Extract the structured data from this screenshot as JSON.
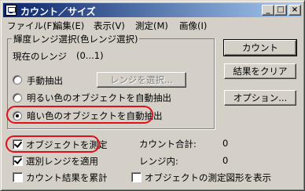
{
  "window": {
    "title": "カウント／サイズ",
    "controls": {
      "minimize": "_",
      "maximize": "□",
      "close": "×"
    }
  },
  "menu": [
    {
      "label": "ファイル(F)"
    },
    {
      "label": "編集(E)"
    },
    {
      "label": "表示(V)"
    },
    {
      "label": "測定(M)"
    },
    {
      "label": "画像(I)"
    }
  ],
  "group": {
    "label": "輝度レンジ選択(色レンジ選択)",
    "current_range_label": "現在のレンジ",
    "current_range_value": "(0...1)"
  },
  "radios": {
    "manual": {
      "label": "手動抽出",
      "checked": false
    },
    "bright": {
      "label": "明るい色のオブジェクトを自動抽出",
      "checked": false
    },
    "dark": {
      "label": "暗い色のオブジェクトを自動抽出",
      "checked": true
    }
  },
  "buttons": {
    "select_range": "レンジを選択...",
    "count": "カウント",
    "clear_results": "結果をクリア",
    "options": "オプション..."
  },
  "checkboxes": {
    "measure_objects": {
      "label": "オブジェクトを測定",
      "checked": true
    },
    "apply_filter_ranges": {
      "label": "選別レンジを適用",
      "checked": true
    },
    "accumulate_count": {
      "label": "カウント結果を累計",
      "checked": false
    },
    "display_object_outlines": {
      "label": "オブジェクトの測定図形を表示",
      "checked": false
    }
  },
  "stats": {
    "total_count_label": "カウント合計:",
    "total_count_value": "0",
    "in_range_label": "レンジ内:",
    "in_range_value": "0"
  },
  "highlights": {
    "color": "#e0101a"
  },
  "colors": {
    "face": "#d4d0c8",
    "title_start": "#0a246a",
    "title_end": "#a6caf0"
  }
}
